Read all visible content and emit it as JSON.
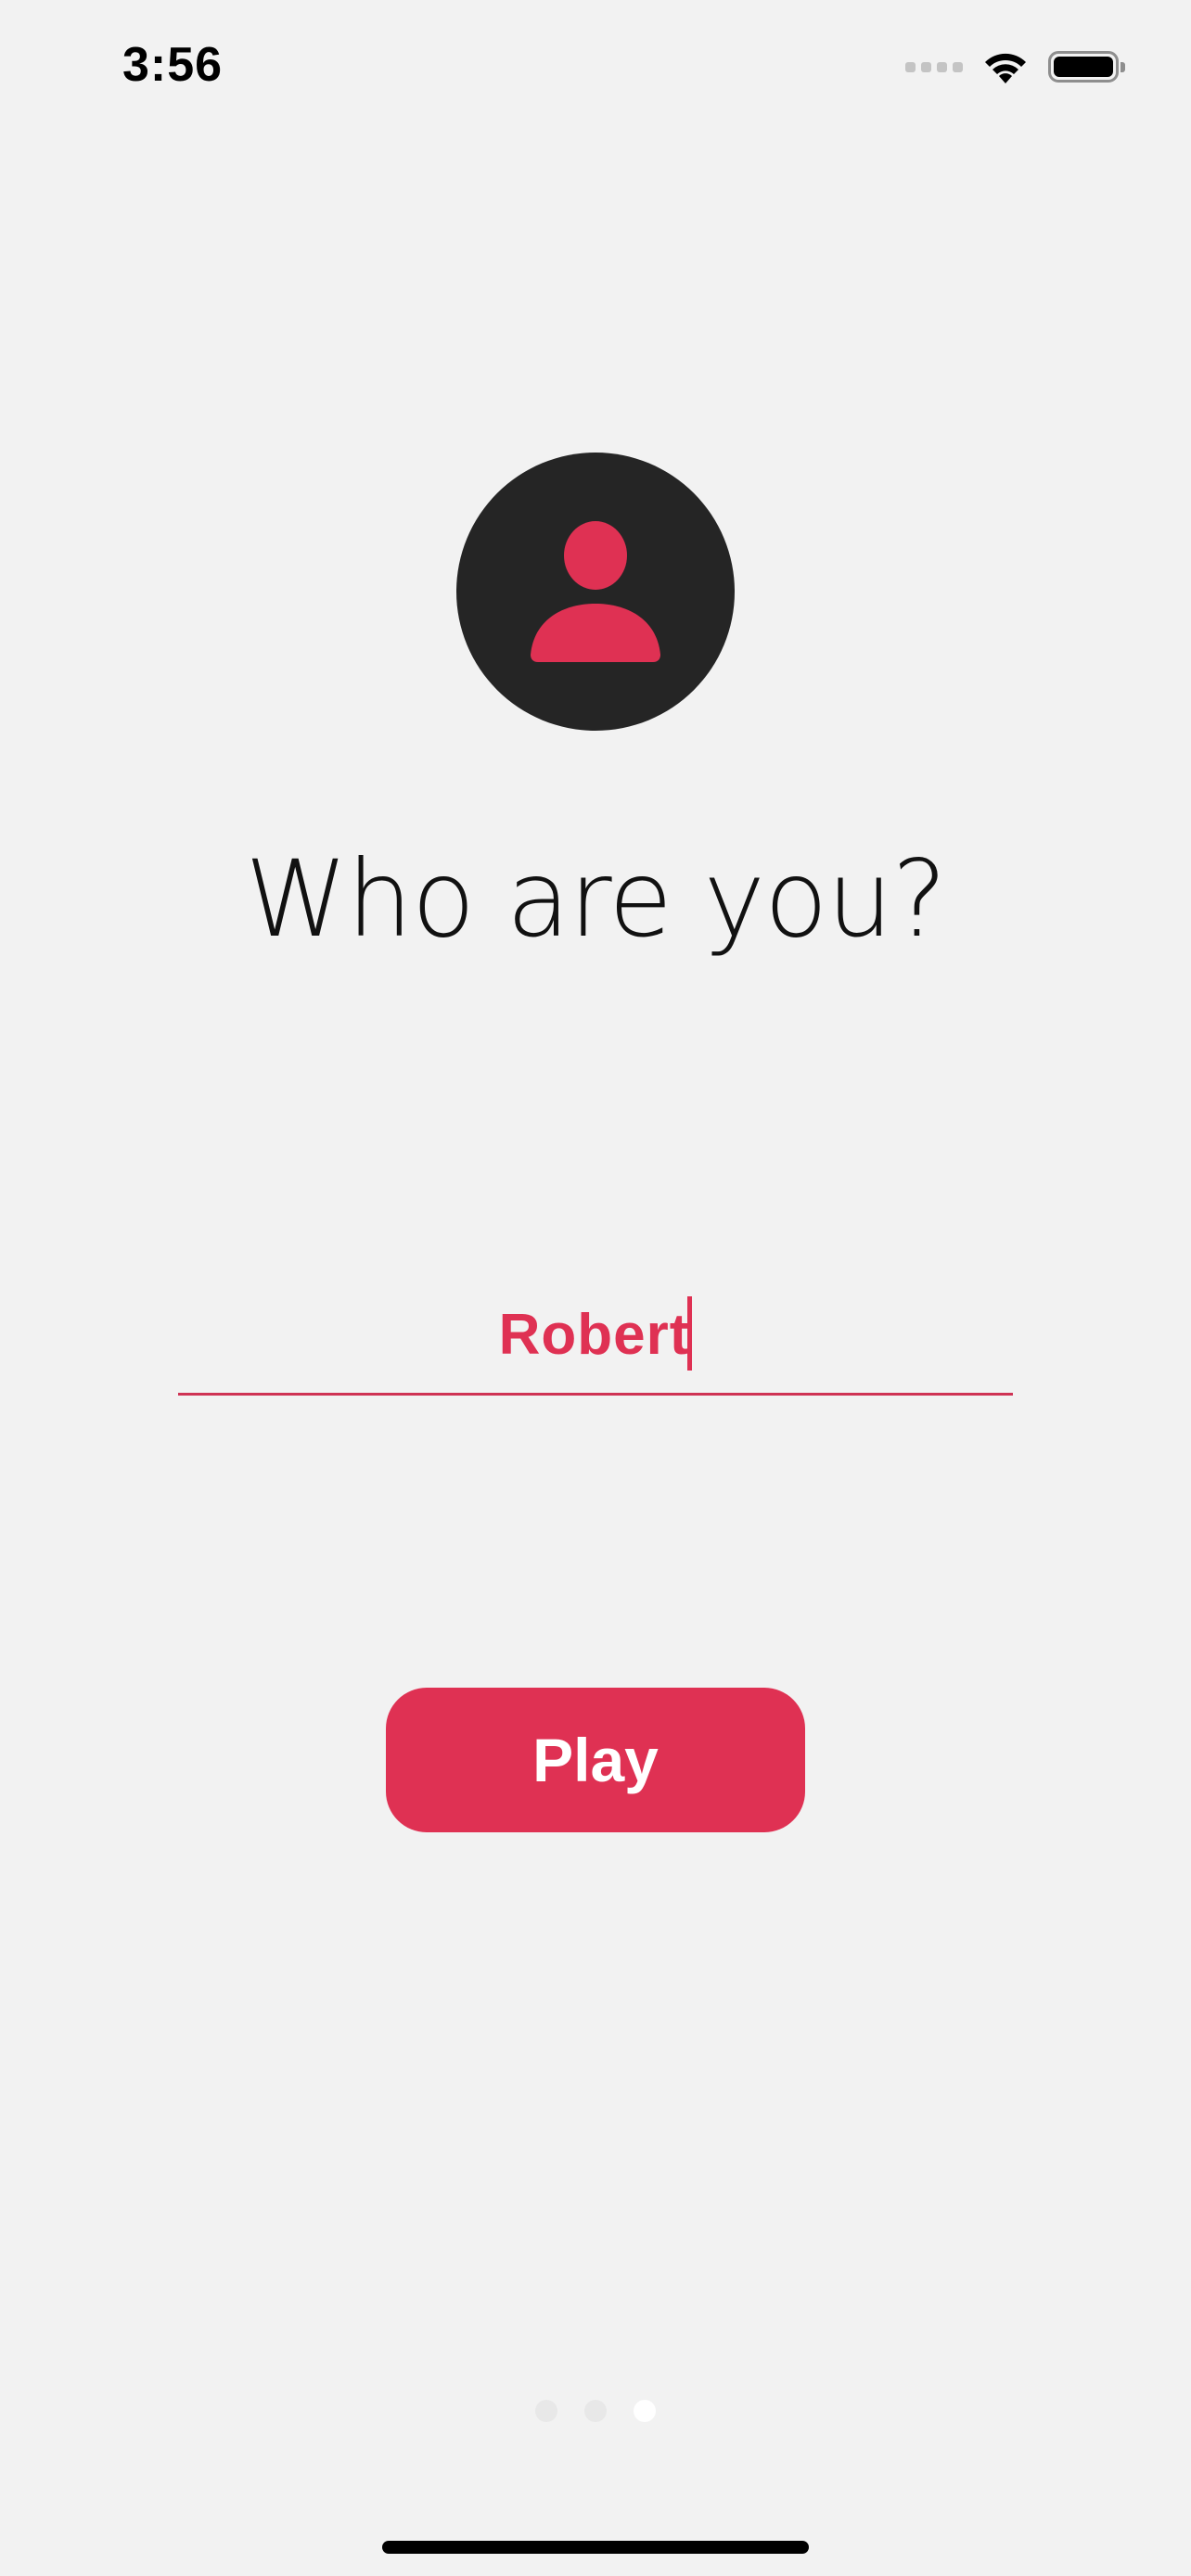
{
  "status_bar": {
    "time": "3:56",
    "icons": [
      "cellular-signal-icon",
      "wifi-icon",
      "battery-icon"
    ]
  },
  "avatar": {
    "icon": "person-icon",
    "background_color": "#252525",
    "icon_color": "#df3153"
  },
  "title": "Who are you?",
  "name_input": {
    "value": "Robert",
    "underline_color": "#cf3354",
    "text_color": "#df3153"
  },
  "play_button": {
    "label": "Play",
    "color": "#df3153"
  },
  "page_indicator": {
    "total": 3,
    "current": 3
  }
}
